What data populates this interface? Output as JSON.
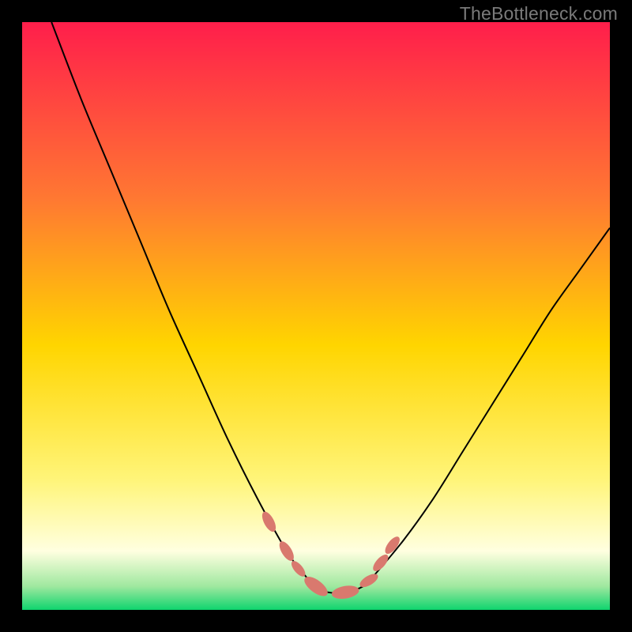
{
  "watermark": "TheBottleneck.com",
  "chart_data": {
    "type": "line",
    "title": "",
    "xlabel": "",
    "ylabel": "",
    "xlim": [
      0,
      100
    ],
    "ylim": [
      0,
      100
    ],
    "grid": false,
    "legend": false,
    "background_gradient": [
      {
        "pos": 0.0,
        "color": "#ff1e4b"
      },
      {
        "pos": 0.3,
        "color": "#ff7832"
      },
      {
        "pos": 0.55,
        "color": "#ffd500"
      },
      {
        "pos": 0.78,
        "color": "#fff57a"
      },
      {
        "pos": 0.9,
        "color": "#ffffe0"
      },
      {
        "pos": 0.96,
        "color": "#9fe89f"
      },
      {
        "pos": 1.0,
        "color": "#0fd46e"
      }
    ],
    "series": [
      {
        "name": "bottleneck-curve",
        "x": [
          5,
          10,
          15,
          20,
          25,
          30,
          35,
          40,
          45,
          48,
          50,
          52,
          55,
          58,
          60,
          65,
          70,
          75,
          80,
          85,
          90,
          95,
          100
        ],
        "values": [
          100,
          87,
          75,
          63,
          51,
          40,
          29,
          19,
          10,
          6,
          4,
          3,
          3,
          4,
          6,
          12,
          19,
          27,
          35,
          43,
          51,
          58,
          65
        ]
      }
    ],
    "markers": {
      "name": "highlight-points",
      "color": "#d9796e",
      "points": [
        {
          "x": 42,
          "y": 15,
          "r": 2.8
        },
        {
          "x": 45,
          "y": 10,
          "r": 2.8
        },
        {
          "x": 47,
          "y": 7,
          "r": 2.4
        },
        {
          "x": 50,
          "y": 4,
          "r": 3.5
        },
        {
          "x": 55,
          "y": 3,
          "r": 3.5
        },
        {
          "x": 59,
          "y": 5,
          "r": 2.6
        },
        {
          "x": 61,
          "y": 8,
          "r": 2.6
        },
        {
          "x": 63,
          "y": 11,
          "r": 2.6
        }
      ]
    }
  }
}
